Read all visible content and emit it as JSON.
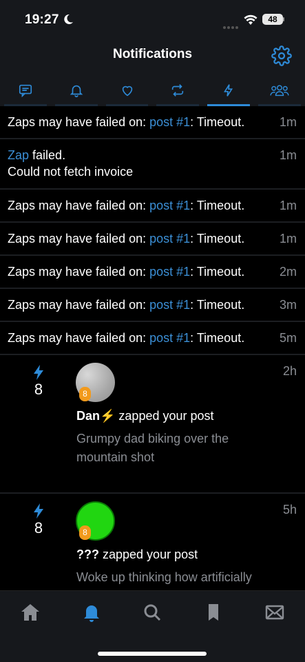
{
  "status": {
    "time": "19:27",
    "battery": "48",
    "icons": [
      "moon-icon",
      "signal-icon",
      "wifi-icon",
      "battery-icon"
    ]
  },
  "header": {
    "title": "Notifications",
    "settings_icon": "gear-icon"
  },
  "tabs": [
    {
      "icon": "chat-icon",
      "active": false
    },
    {
      "icon": "bell-icon",
      "active": false
    },
    {
      "icon": "heart-icon",
      "active": false
    },
    {
      "icon": "repost-icon",
      "active": false
    },
    {
      "icon": "lightning-icon",
      "active": true
    },
    {
      "icon": "group-icon",
      "active": false
    }
  ],
  "failures": [
    {
      "prefix": "Zaps may have failed on: ",
      "link": "post #1",
      "suffix": ": Timeout.",
      "time": "1m"
    },
    {
      "link": "Zap",
      "line1": " failed.",
      "line2": "Could not fetch invoice",
      "time": "1m"
    },
    {
      "prefix": "Zaps may have failed on: ",
      "link": "post #1",
      "suffix": ": Timeout.",
      "time": "1m"
    },
    {
      "prefix": "Zaps may have failed on: ",
      "link": "post #1",
      "suffix": ": Timeout.",
      "time": "1m"
    },
    {
      "prefix": "Zaps may have failed on: ",
      "link": "post #1",
      "suffix": ": Timeout.",
      "time": "2m"
    },
    {
      "prefix": "Zaps may have failed on: ",
      "link": "post #1",
      "suffix": ": Timeout.",
      "time": "3m"
    },
    {
      "prefix": "Zaps may have failed on: ",
      "link": "post #1",
      "suffix": ": Timeout.",
      "time": "5m"
    }
  ],
  "zaps": [
    {
      "amount": "8",
      "time": "2h",
      "badge": "8",
      "name": "Dan⚡",
      "action": " zapped your post",
      "body": "Grumpy dad biking over the mountain shot"
    },
    {
      "amount": "8",
      "time": "5h",
      "badge": "8",
      "name": "???",
      "action": " zapped your post",
      "body": "Woke up thinking how artificially"
    }
  ],
  "bottom_nav": [
    {
      "icon": "home-icon",
      "active": false
    },
    {
      "icon": "bell-icon",
      "active": true
    },
    {
      "icon": "search-icon",
      "active": false
    },
    {
      "icon": "bookmark-icon",
      "active": false
    },
    {
      "icon": "mail-icon",
      "active": false
    }
  ],
  "colors": {
    "accent": "#3b8fd6",
    "zap_badge": "#f29a1c",
    "background": "#000000",
    "bar": "#16181c"
  }
}
